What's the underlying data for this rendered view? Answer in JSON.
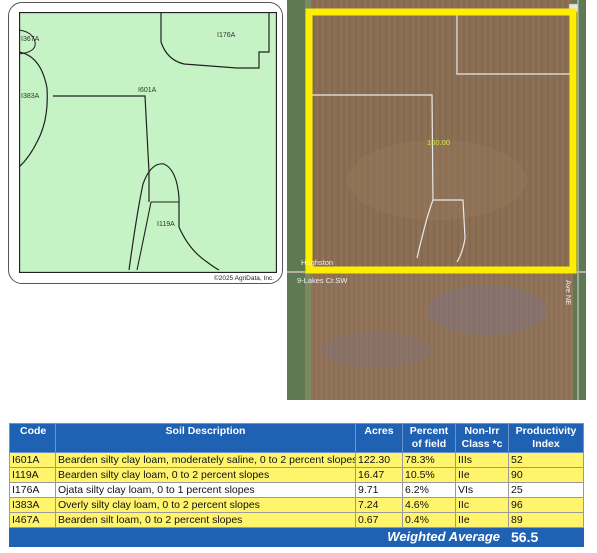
{
  "soil_map": {
    "labels": {
      "i367a": "I367A",
      "i176a": "I176A",
      "i383a": "I383A",
      "i601a": "I601A",
      "i119a": "I119A"
    },
    "copyright": "©2025 AgriData, Inc.",
    "fill_color": "#c6f3c6"
  },
  "aerial": {
    "acreage_label": "160.00",
    "road_label_left": "Hughston",
    "road_label_left_lower": "9-Lakes Cr.SW",
    "road_label_right": "Ave NE",
    "boundary_color": "#ffee00"
  },
  "table": {
    "headers": {
      "code": "Code",
      "description": "Soil Description",
      "acres": "Acres",
      "percent_l1": "Percent",
      "percent_l2": "of field",
      "class_l1": "Non-Irr",
      "class_l2": "Class *c",
      "pi_l1": "Productivity",
      "pi_l2": "Index"
    },
    "rows": [
      {
        "code": "I601A",
        "description": "Bearden silty clay loam, moderately saline, 0 to 2 percent slopes",
        "acres": "122.30",
        "percent": "78.3%",
        "class": "IIIs",
        "pi": "52"
      },
      {
        "code": "I119A",
        "description": "Bearden silty clay loam, 0 to 2 percent slopes",
        "acres": "16.47",
        "percent": "10.5%",
        "class": "IIe",
        "pi": "90"
      },
      {
        "code": "I176A",
        "description": "Ojata silty clay loam, 0 to 1 percent slopes",
        "acres": "9.71",
        "percent": "6.2%",
        "class": "VIs",
        "pi": "25"
      },
      {
        "code": "I383A",
        "description": "Overly silty clay loam, 0 to 2 percent slopes",
        "acres": "7.24",
        "percent": "4.6%",
        "class": "IIc",
        "pi": "96"
      },
      {
        "code": "I467A",
        "description": "Bearden silt loam, 0 to 2 percent slopes",
        "acres": "0.67",
        "percent": "0.4%",
        "class": "IIe",
        "pi": "89"
      }
    ],
    "weighted_average_label": "Weighted Average",
    "weighted_average_value": "56.5",
    "header_color": "#1f62b3",
    "highlight_color": "#fff46b"
  }
}
